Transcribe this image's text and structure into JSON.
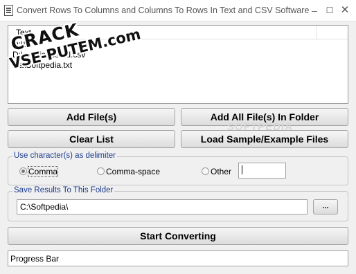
{
  "window": {
    "title": "Convert Rows To Columns and Columns To Rows In Text and CSV Software",
    "min_glyph": "–",
    "max_glyph": "☐",
    "close_glyph": "✕"
  },
  "file_list": {
    "column_header": "Text",
    "rows": [
      "D:\\S",
      "D:\\        pedia tested.csv",
      "          dia\\Softpedia.txt"
    ]
  },
  "watermark": {
    "line1": "CRACK",
    "line2": "VSE-PUTEM.com"
  },
  "buttons": {
    "add_files": "Add File(s)",
    "add_all_files": "Add All File(s) In Folder",
    "clear_list": "Clear List",
    "load_sample": "Load Sample/Example Files",
    "start_converting": "Start Converting",
    "browse": "..."
  },
  "softpedia_mark": "SOFTPEDIA",
  "delimiter": {
    "legend": "Use character(s) as delimiter",
    "options": [
      "Comma",
      "Comma-space",
      "Other"
    ],
    "selected": "Comma",
    "other_value": ""
  },
  "save_results": {
    "legend": "Save Results To This Folder",
    "folder": "C:\\Softpedia\\"
  },
  "progress": {
    "label": "Progress Bar"
  },
  "colors": {
    "legend_text": "#1a3a8c",
    "window_bg": "#f0f0f0"
  }
}
